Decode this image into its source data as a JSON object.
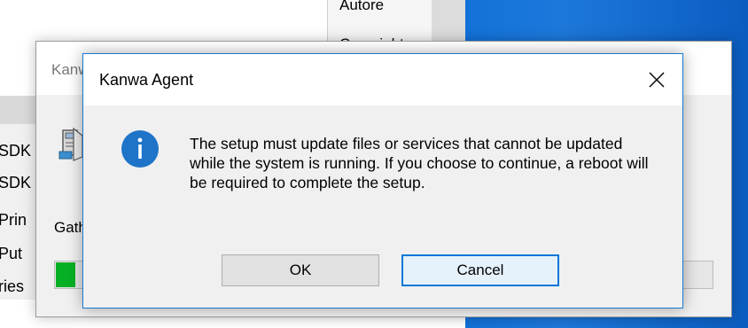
{
  "background": {
    "column_items": [
      "Autore",
      "Copyright"
    ],
    "left_list": [
      "SDK",
      "SDK",
      "Prin",
      "Put",
      "ries"
    ]
  },
  "setup_window": {
    "title": "Kanwa Agent Setup",
    "status": "Gathering required information...",
    "progress_fraction": 0.03
  },
  "dialog": {
    "title": "Kanwa Agent",
    "close_icon": "close-icon",
    "icon": "info-icon",
    "message": "The setup must update files or services that cannot be updated while the system is running. If you choose to continue, a reboot will be required to complete the setup.",
    "buttons": {
      "ok": "OK",
      "cancel": "Cancel"
    }
  },
  "colors": {
    "desktop": "#0a62c4",
    "progress": "#06b025",
    "accent": "#0078d7",
    "info_icon": "#1e74c8"
  }
}
